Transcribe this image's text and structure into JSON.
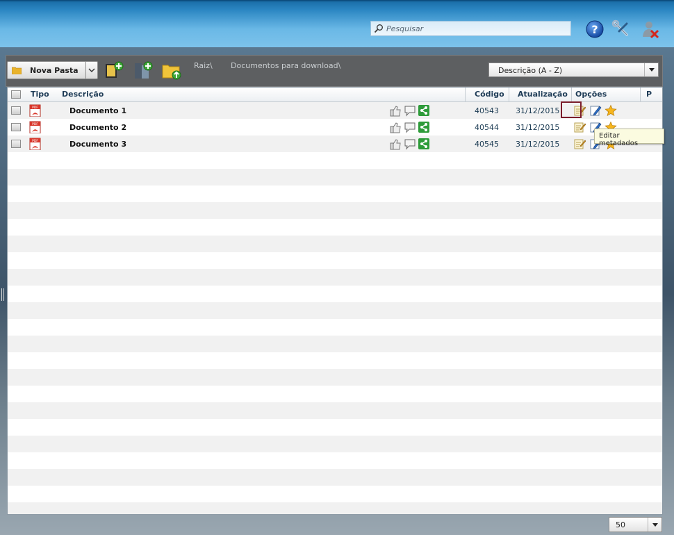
{
  "header": {
    "search": {
      "placeholder": "Pesquisar",
      "value": ""
    },
    "icons": [
      "help-icon",
      "tools-icon",
      "logout-icon"
    ]
  },
  "toolbar": {
    "new_folder_label": "Nova Pasta",
    "breadcrumb": [
      "Raiz\\",
      "Documentos para download\\"
    ],
    "sort": {
      "selected": "Descrição (A - Z)"
    }
  },
  "table": {
    "columns": {
      "tipo": "Tipo",
      "descricao": "Descrição",
      "codigo": "Código",
      "atualizacao": "Atualização",
      "opcoes": "Opções",
      "p": "P"
    },
    "rows": [
      {
        "descricao": "Documento 1",
        "codigo": "40543",
        "atualizacao": "31/12/2015",
        "tipo_icon": "pdf-icon"
      },
      {
        "descricao": "Documento 2",
        "codigo": "40544",
        "atualizacao": "31/12/2015",
        "tipo_icon": "pdf-icon"
      },
      {
        "descricao": "Documento 3",
        "codigo": "40545",
        "atualizacao": "31/12/2015",
        "tipo_icon": "pdf-icon"
      }
    ]
  },
  "tooltip": {
    "text": "Editar metadados"
  },
  "pager": {
    "page_size": "50"
  },
  "colors": {
    "header_blue": "#2b86c2",
    "share_green": "#2e9b3a",
    "accent_dark_red": "#7b1d2b"
  }
}
